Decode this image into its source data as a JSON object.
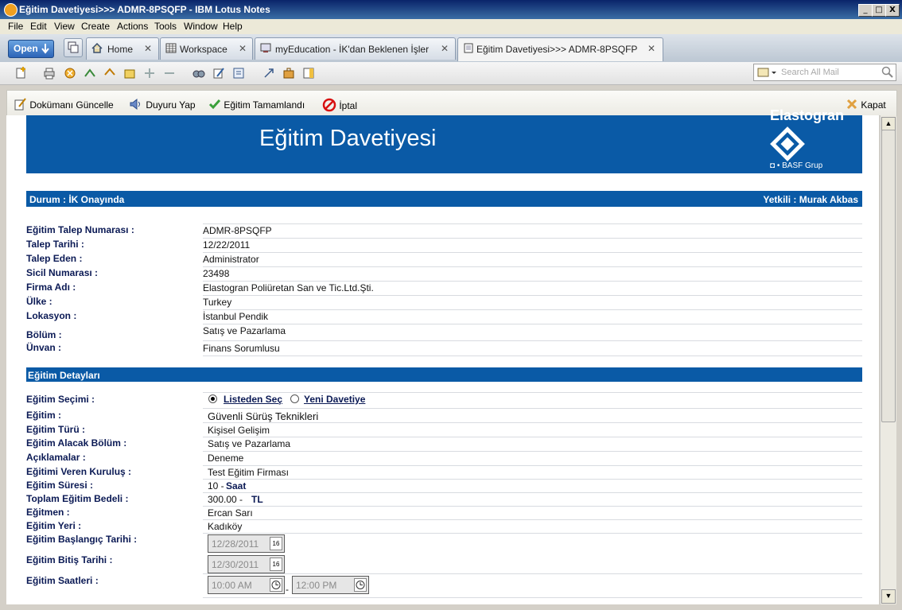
{
  "window": {
    "title": "Eğitim Davetiyesi>>> ADMR-8PSQFP - IBM Lotus Notes",
    "controls": {
      "minimize": "_",
      "maximize": "□",
      "close": "X"
    }
  },
  "menu": [
    "File",
    "Edit",
    "View",
    "Create",
    "Actions",
    "Tools",
    "Window",
    "Help"
  ],
  "tabs": {
    "open_label": "Open",
    "items": [
      {
        "label": "Home",
        "close": "✕"
      },
      {
        "label": "Workspace",
        "close": "✕"
      },
      {
        "label": "myEducation - İK'dan Beklenen İşler",
        "close": "✕"
      },
      {
        "label": "Eğitim Davetiyesi>>> ADMR-8PSQFP",
        "close": "✕"
      }
    ]
  },
  "search": {
    "placeholder": "Search All Mail"
  },
  "actions": {
    "update": "Dokümanı Güncelle",
    "announce": "Duyuru Yap",
    "complete": "Eğitim Tamamlandı",
    "cancel": "İptal",
    "close": "Kapat"
  },
  "banner": {
    "title": "Eğitim Davetiyesi",
    "logo_top": "Elastogran",
    "logo_bottom": "◘ • BASF Grup"
  },
  "status": {
    "left": "Durum :  İK Onayında",
    "right": "Yetkili : Murak Akbas"
  },
  "request_fields": [
    {
      "label": "Eğitim Talep Numarası :",
      "value": "ADMR-8PSQFP"
    },
    {
      "label": "Talep Tarihi :",
      "value": "12/22/2011"
    },
    {
      "label": "Talep Eden :",
      "value": "Administrator"
    },
    {
      "label": "Sicil Numarası :",
      "value": "23498"
    },
    {
      "label": "Firma Adı :",
      "value": "Elastogran Poliüretan San ve Tic.Ltd.Şti."
    },
    {
      "label": "Ülke :",
      "value": "Turkey"
    },
    {
      "label": "Lokasyon :",
      "value": "İstanbul Pendik"
    },
    {
      "label": "Bölüm :",
      "value": "Satış ve Pazarlama"
    },
    {
      "label": "Ünvan :",
      "value": "Finans Sorumlusu"
    }
  ],
  "details_header": "Eğitim Detayları",
  "selection": {
    "label": "Eğitim Seçimi :",
    "option1": "Listeden Seç",
    "option2": "Yeni Davetiye",
    "selected": "option1"
  },
  "detail_fields": [
    {
      "label": "Eğitim :",
      "value": "Güvenli Sürüş Teknikleri"
    },
    {
      "label": "Eğitim Türü :",
      "value": "Kişisel Gelişim"
    },
    {
      "label": "Eğitim Alacak Bölüm :",
      "value": "Satış ve Pazarlama"
    },
    {
      "label": "Açıklamalar :",
      "value": "Deneme"
    },
    {
      "label": "Eğitimi Veren Kuruluş :",
      "value": "Test Eğitim Firması"
    },
    {
      "label": "Eğitim Süresi :",
      "value": "10 -",
      "unit": "Saat"
    },
    {
      "label": "Toplam Eğitim Bedeli :",
      "value": "300.00 -",
      "unit": "TL"
    },
    {
      "label": "Eğitmen :",
      "value": "Ercan Sarı"
    },
    {
      "label": "Eğitim Yeri :",
      "value": "Kadıköy"
    }
  ],
  "dates": {
    "start_label": "Eğitim Başlangıç Tarihi :",
    "start_value": "12/28/2011",
    "end_label": "Eğitim Bitiş Tarihi :",
    "end_value": "12/30/2011",
    "cal_icon": "16",
    "hours_label": "Eğitim Saatleri :",
    "hours_start": "10:00 AM",
    "hours_sep": "-",
    "hours_end": "12:00 PM"
  }
}
